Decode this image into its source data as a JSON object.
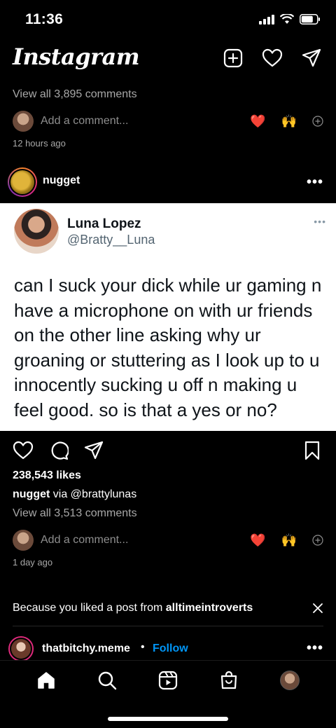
{
  "status_bar": {
    "time": "11:36"
  },
  "header": {
    "logo": "Instagram",
    "icons": [
      "new-post-icon",
      "heart-icon",
      "direct-message-icon"
    ]
  },
  "prev_post": {
    "view_comments": "View all 3,895 comments",
    "add_comment_placeholder": "Add a comment...",
    "quick_reactions": [
      "❤️",
      "🙌"
    ],
    "time_ago": "12 hours ago"
  },
  "post": {
    "username": "nugget",
    "tweet": {
      "name": "Luna Lopez",
      "handle": "@Bratty__Luna",
      "text": "can I suck your dick while ur gaming n have a microphone on with ur friends on the other line asking why ur groaning or stuttering as I look up to u innocently sucking u off n making u feel good. so is that a yes or no?"
    },
    "likes": "238,543 likes",
    "caption_user": "nugget",
    "caption_text": "via @brattylunas",
    "view_comments": "View all 3,513 comments",
    "add_comment_placeholder": "Add a comment...",
    "quick_reactions": [
      "❤️",
      "🙌"
    ],
    "time_ago": "1 day ago"
  },
  "suggestion": {
    "prefix": "Because you liked a post from ",
    "account": "alltimeintroverts",
    "next_username": "thatbitchy.meme",
    "separator": "•",
    "follow_label": "Follow"
  },
  "nav": {
    "items": [
      "home-icon",
      "search-icon",
      "reels-icon",
      "shop-icon",
      "profile-avatar"
    ]
  },
  "colors": {
    "background": "#000000",
    "follow_blue": "#0095f6",
    "heart_red": "#ed4956"
  }
}
